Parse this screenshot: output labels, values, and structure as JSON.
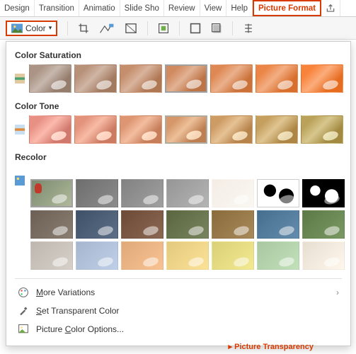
{
  "tabs": {
    "design": "Design",
    "transitions": "Transition",
    "animations": "Animatio",
    "slideshow": "Slide Sho",
    "review": "Review",
    "view": "View",
    "help": "Help",
    "picture_format": "Picture Format"
  },
  "toolbar": {
    "color_label": "Color"
  },
  "dropdown": {
    "section_saturation": "Color Saturation",
    "section_tone": "Color Tone",
    "section_recolor": "Recolor",
    "more_variations": "More Variations",
    "set_transparent": "Set Transparent Color",
    "picture_color_options": "Picture Color Options..."
  },
  "saturation": {
    "count": 7,
    "selected_index": 3
  },
  "tone": {
    "count": 7,
    "selected_index": 3
  },
  "recolor": {
    "row1_colors": [
      "nat",
      "gray1",
      "gray2",
      "gray3",
      "washout",
      "bw1",
      "bw2"
    ],
    "row2_colors": [
      "#6c6055",
      "#3f5168",
      "#6d4a36",
      "#5a6640",
      "#8a6b3c",
      "#466e8e",
      "#5c7a46"
    ],
    "row3_colors": [
      "#bdb7af",
      "#a7b6cf",
      "#e0a97a",
      "#e3c97e",
      "#d9d078",
      "#a9c7a0",
      "#e7ded2"
    ],
    "selected_index": 0
  },
  "footer": {
    "picture_transparency": "Picture Transparency"
  }
}
